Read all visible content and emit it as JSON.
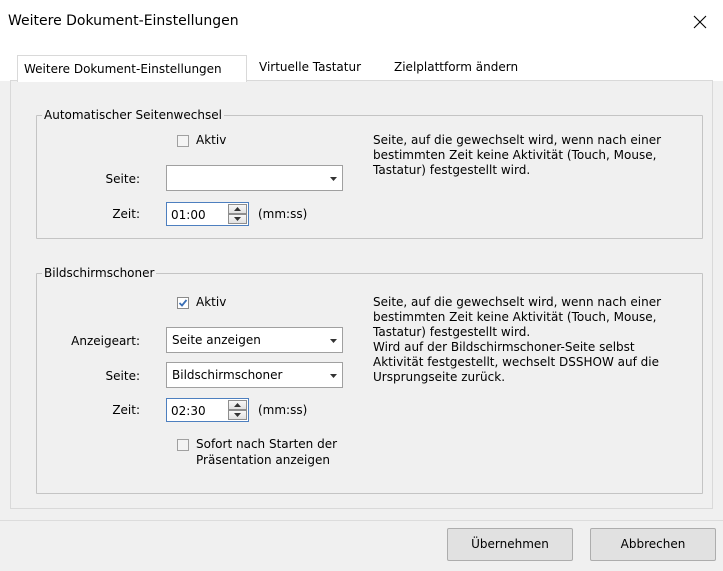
{
  "window": {
    "title": "Weitere Dokument-Einstellungen",
    "close_icon": "close-x-icon"
  },
  "tabs": [
    {
      "label": "Weitere Dokument-Einstellungen",
      "active": true
    },
    {
      "label": "Virtuelle Tastatur",
      "active": false
    },
    {
      "label": "Zielplattform ändern",
      "active": false
    }
  ],
  "auto_page_change": {
    "legend": "Automatischer Seitenwechsel",
    "active_label": "Aktiv",
    "active_checked": false,
    "page_label": "Seite:",
    "page_value": "",
    "time_label": "Zeit:",
    "time_value": "01:00",
    "time_unit": "(mm:ss)",
    "description": "Seite, auf die gewechselt wird, wenn nach einer bestimmten Zeit keine Aktivität (Touch, Mouse, Tastatur) festgestellt wird."
  },
  "screensaver": {
    "legend": "Bildschirmschoner",
    "active_label": "Aktiv",
    "active_checked": true,
    "display_type_label": "Anzeigeart:",
    "display_type_value": "Seite anzeigen",
    "page_label": "Seite:",
    "page_value": "Bildschirmschoner",
    "time_label": "Zeit:",
    "time_value": "02:30",
    "time_unit": "(mm:ss)",
    "immediate_label_line1": "Sofort nach Starten der",
    "immediate_label_line2": "Präsentation anzeigen",
    "immediate_checked": false,
    "description_line1": "Seite, auf die gewechselt wird, wenn nach einer",
    "description_line2": "bestimmten Zeit keine Aktivität (Touch, Mouse,",
    "description_line3": "Tastatur) festgestellt wird.",
    "description_line4": "Wird auf der Bildschirmschoner-Seite selbst",
    "description_line5": "Aktivität festgestellt, wechselt DSSHOW auf die",
    "description_line6": "Ursprungseite zurück."
  },
  "buttons": {
    "apply": "Übernehmen",
    "cancel": "Abbrechen"
  },
  "colors": {
    "window_bg": "#f0f0f0",
    "checkmark": "#3a6fb5",
    "spin_focus_border": "#4d7fbf"
  }
}
